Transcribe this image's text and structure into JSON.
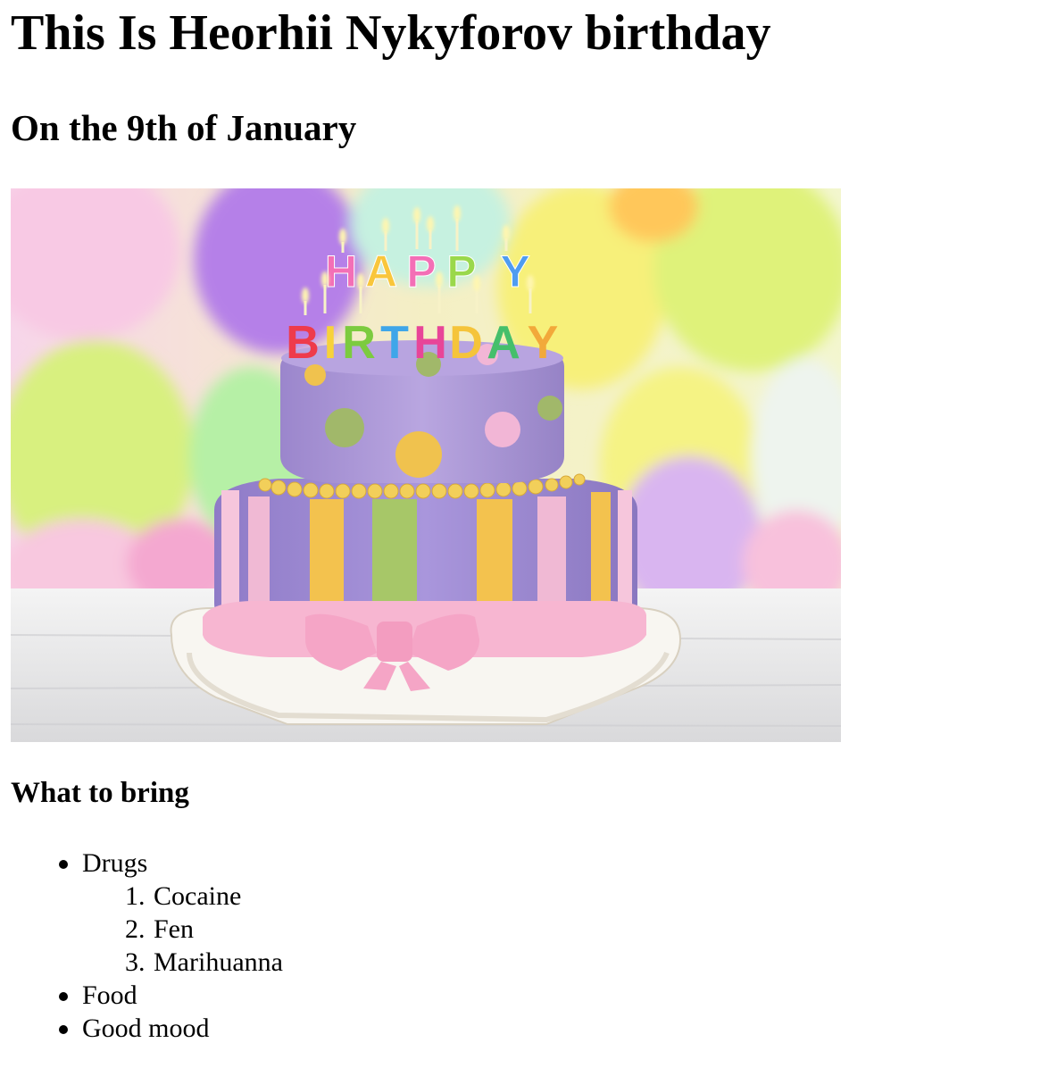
{
  "header": {
    "title": "This Is Heorhii Nykyforov birthday",
    "date": "On the 9th of January"
  },
  "hero_image": {
    "depicts": "birthday-cake-with-candles-and-balloons",
    "candle_letters_top": "HAPPY",
    "candle_letters_bottom": "BIRTHDAY"
  },
  "bring": {
    "heading": "What to bring",
    "items": [
      {
        "label": "Drugs",
        "sub": [
          {
            "num": "1.",
            "label": "Cocaine"
          },
          {
            "num": "2.",
            "label": "Fen"
          },
          {
            "num": "3.",
            "label": "Marihuanna"
          }
        ]
      },
      {
        "label": "Food"
      },
      {
        "label": "Good mood"
      }
    ]
  }
}
